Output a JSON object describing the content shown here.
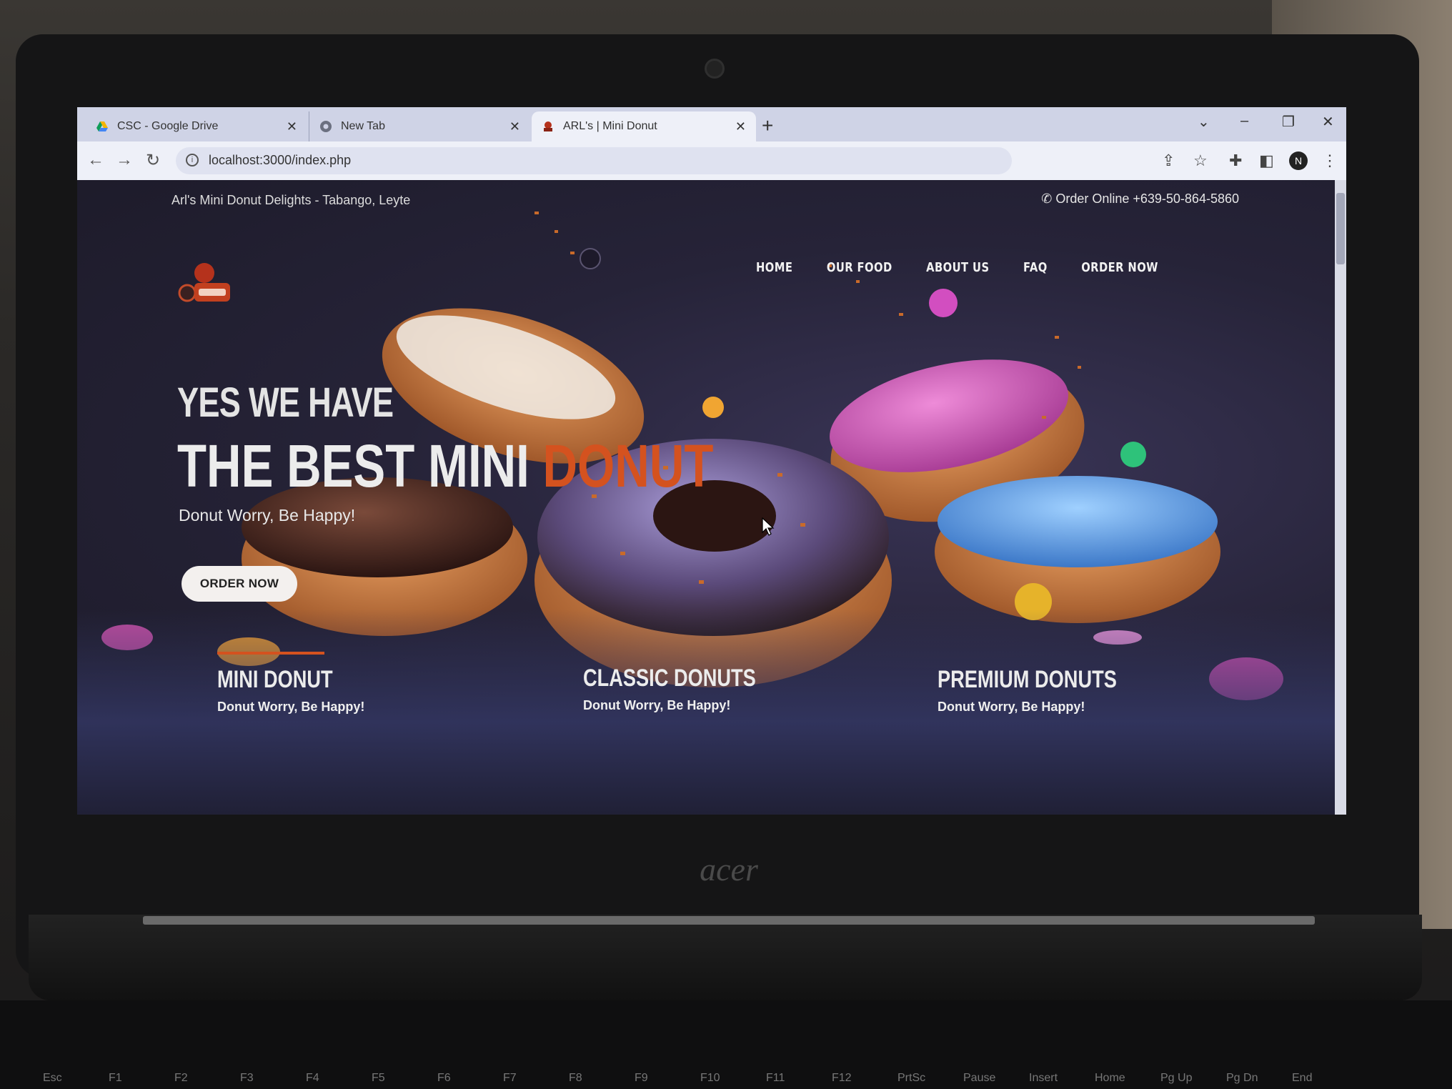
{
  "browser": {
    "tabs": [
      {
        "label": "CSC - Google Drive",
        "icon": "google-drive-icon"
      },
      {
        "label": "New Tab",
        "icon": "chrome-icon"
      },
      {
        "label": "ARL's | Mini Donut",
        "icon": "site-logo-icon",
        "active": true
      }
    ],
    "url": "localhost:3000/index.php",
    "profile_initial": "N"
  },
  "site": {
    "topbar_text": "Arl's Mini Donut Delights - Tabango, Leyte",
    "phone_text": "Order Online +639-50-864-5860",
    "nav": [
      "HOME",
      "OUR FOOD",
      "ABOUT US",
      "FAQ",
      "ORDER NOW"
    ],
    "hero": {
      "line1": "YES WE HAVE",
      "line2_main": "THE BEST MINI",
      "line2_accent": "DONUT",
      "tagline": "Donut Worry, Be Happy!",
      "button": "ORDER NOW"
    },
    "categories": [
      {
        "title": "MINI DONUT",
        "subtitle": "Donut Worry, Be Happy!"
      },
      {
        "title": "CLASSIC DONUTS",
        "subtitle": "Donut Worry, Be Happy!"
      },
      {
        "title": "PREMIUM DONUTS",
        "subtitle": "Donut Worry, Be Happy!"
      }
    ],
    "accent_color": "#d4521f"
  },
  "device": {
    "brand": "acer",
    "fkeys": [
      "Esc",
      "F1",
      "F2",
      "F3",
      "F4",
      "F5",
      "F6",
      "F7",
      "F8",
      "F9",
      "F10",
      "F11",
      "F12",
      "PrtSc",
      "Pause",
      "Insert",
      "Home",
      "Pg Up",
      "Pg Dn",
      "End"
    ]
  }
}
